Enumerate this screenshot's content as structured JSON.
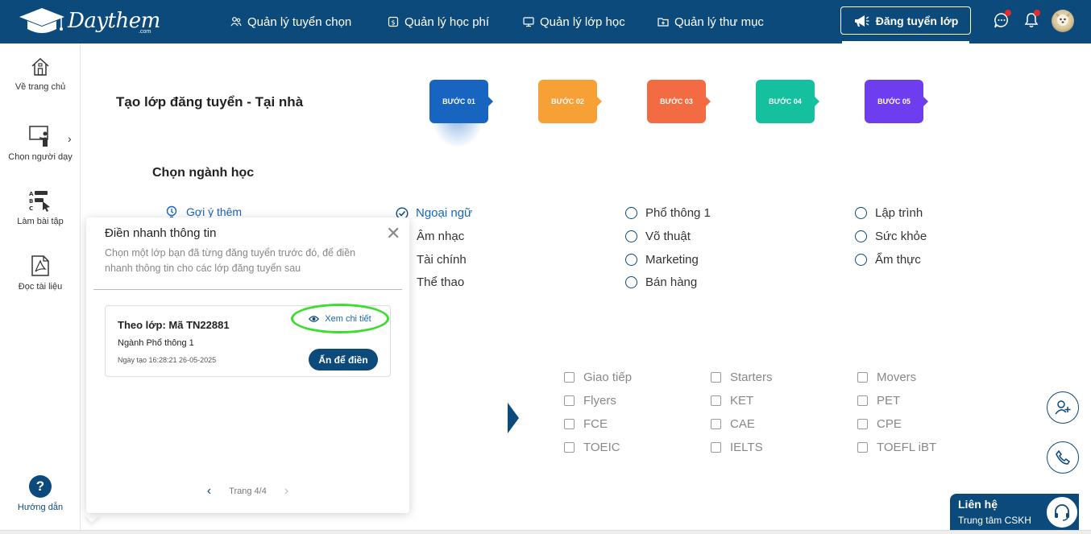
{
  "header": {
    "brand": "Daythem",
    "brand_suffix": ".com",
    "nav": [
      {
        "label": "Quản lý tuyển chọn",
        "icon": "users-icon"
      },
      {
        "label": "Quản lý học phí",
        "icon": "money-icon"
      },
      {
        "label": "Quản lý lớp học",
        "icon": "monitor-icon"
      },
      {
        "label": "Quản lý thư mục",
        "icon": "folder-icon"
      }
    ],
    "post_button": "Đăng tuyển lớp"
  },
  "sidebar": {
    "items": [
      {
        "label": "Về trang chủ",
        "icon": "home-icon"
      },
      {
        "label": "Chọn người dạy",
        "icon": "teacher-board-icon"
      },
      {
        "label": "Làm bài tập",
        "icon": "exercise-icon"
      },
      {
        "label": "Đọc tài liệu",
        "icon": "pdf-icon"
      }
    ],
    "help": {
      "label": "Hướng dẫn",
      "symbol": "?"
    }
  },
  "main": {
    "title": "Tạo lớp đăng tuyển - Tại nhà",
    "steps": [
      {
        "label": "BƯỚC 01",
        "color": "#1764c1"
      },
      {
        "label": "BƯỚC 02",
        "color": "#f7a035"
      },
      {
        "label": "BƯỚC 03",
        "color": "#f26b43"
      },
      {
        "label": "BƯỚC 04",
        "color": "#14c09e"
      },
      {
        "label": "BƯỚC 05",
        "color": "#6f3df0"
      }
    ],
    "section_title": "Chọn ngành học",
    "suggest": "Gợi ý thêm",
    "majors": {
      "col1": [
        "Ngoại ngữ",
        "Âm nhạc",
        "Tài chính",
        "Thể thao"
      ],
      "col2": [
        "Phổ thông 1",
        "Võ thuật",
        "Marketing",
        "Bán hàng"
      ],
      "col3": [
        "Lập trình",
        "Sức khỏe",
        "Ẩm thực"
      ]
    },
    "subjects": {
      "col1": [
        "Giao tiếp",
        "Flyers",
        "FCE",
        "TOEIC"
      ],
      "col2": [
        "Starters",
        "KET",
        "CAE",
        "IELTS"
      ],
      "col3": [
        "Movers",
        "PET",
        "CPE",
        "TOEFL iBT"
      ]
    }
  },
  "popup": {
    "title": "Điền nhanh thông tin",
    "description": "Chọn một lớp bạn đã từng đăng tuyển trước đó, để điền nhanh thông tin cho các lớp đăng tuyển sau",
    "card": {
      "title": "Theo lớp: Mã TN22881",
      "major": "Ngành Phổ thông 1",
      "created": "Ngày tạo 16:28:21 26-05-2025",
      "view_label": "Xem chi tiết",
      "fill_label": "Ấn để điền"
    },
    "pager": "Trang 4/4"
  },
  "contact": {
    "title": "Liên hệ",
    "subtitle": "Trung tâm CSKH"
  }
}
